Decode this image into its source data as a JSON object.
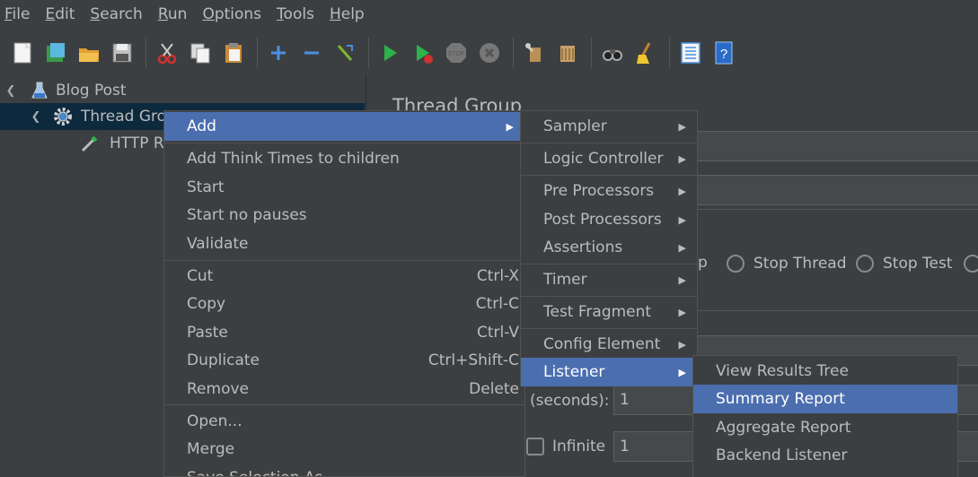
{
  "menubar": {
    "items": [
      {
        "mnemonic": "F",
        "rest": "ile"
      },
      {
        "mnemonic": "E",
        "rest": "dit"
      },
      {
        "mnemonic": "S",
        "rest": "earch"
      },
      {
        "mnemonic": "R",
        "rest": "un"
      },
      {
        "mnemonic": "O",
        "rest": "ptions"
      },
      {
        "mnemonic": "T",
        "rest": "ools"
      },
      {
        "mnemonic": "H",
        "rest": "elp"
      }
    ]
  },
  "toolbar": {
    "icons": [
      "new-icon",
      "templates-icon",
      "open-icon",
      "save-icon",
      "cut-icon",
      "copy-icon",
      "paste-icon",
      "expand-icon",
      "collapse-icon",
      "toggle-icon",
      "start-icon",
      "start-no-pauses-icon",
      "stop-icon",
      "shutdown-icon",
      "clear-icon",
      "clear-all-icon",
      "search-icon",
      "reset-search-icon",
      "function-helper-icon",
      "help-icon"
    ]
  },
  "tree": {
    "test_plan": "Blog Post",
    "thread_group": "Thread Gro",
    "http_request": "HTTP Re"
  },
  "right": {
    "title": "Thread Group",
    "radio_partial": "p",
    "stop_thread": "Stop Thread",
    "stop_test": "Stop Test",
    "seconds_label": "(seconds):",
    "seconds_value": "1",
    "infinite_label": "Infinite",
    "infinite_value": "1"
  },
  "context_menu": {
    "add": "Add",
    "add_think_times": "Add Think Times to children",
    "start": "Start",
    "start_no_pauses": "Start no pauses",
    "validate": "Validate",
    "cut": "Cut",
    "cut_shortcut": "Ctrl-X",
    "copy": "Copy",
    "copy_shortcut": "Ctrl-C",
    "paste": "Paste",
    "paste_shortcut": "Ctrl-V",
    "duplicate": "Duplicate",
    "duplicate_shortcut": "Ctrl+Shift-C",
    "remove": "Remove",
    "remove_shortcut": "Delete",
    "open": "Open...",
    "merge": "Merge",
    "save_selection": "Save Selection As..."
  },
  "add_submenu": {
    "sampler": "Sampler",
    "logic_controller": "Logic Controller",
    "pre_processors": "Pre Processors",
    "post_processors": "Post Processors",
    "assertions": "Assertions",
    "timer": "Timer",
    "test_fragment": "Test Fragment",
    "config_element": "Config Element",
    "listener": "Listener"
  },
  "listener_submenu": {
    "view_results_tree": "View Results Tree",
    "summary_report": "Summary Report",
    "aggregate_report": "Aggregate Report",
    "backend_listener": "Backend Listener"
  },
  "colors": {
    "background": "#3c3f41",
    "highlight": "#4b6eaf",
    "tree_selection": "#0d293e",
    "text": "#bbbbbb"
  }
}
